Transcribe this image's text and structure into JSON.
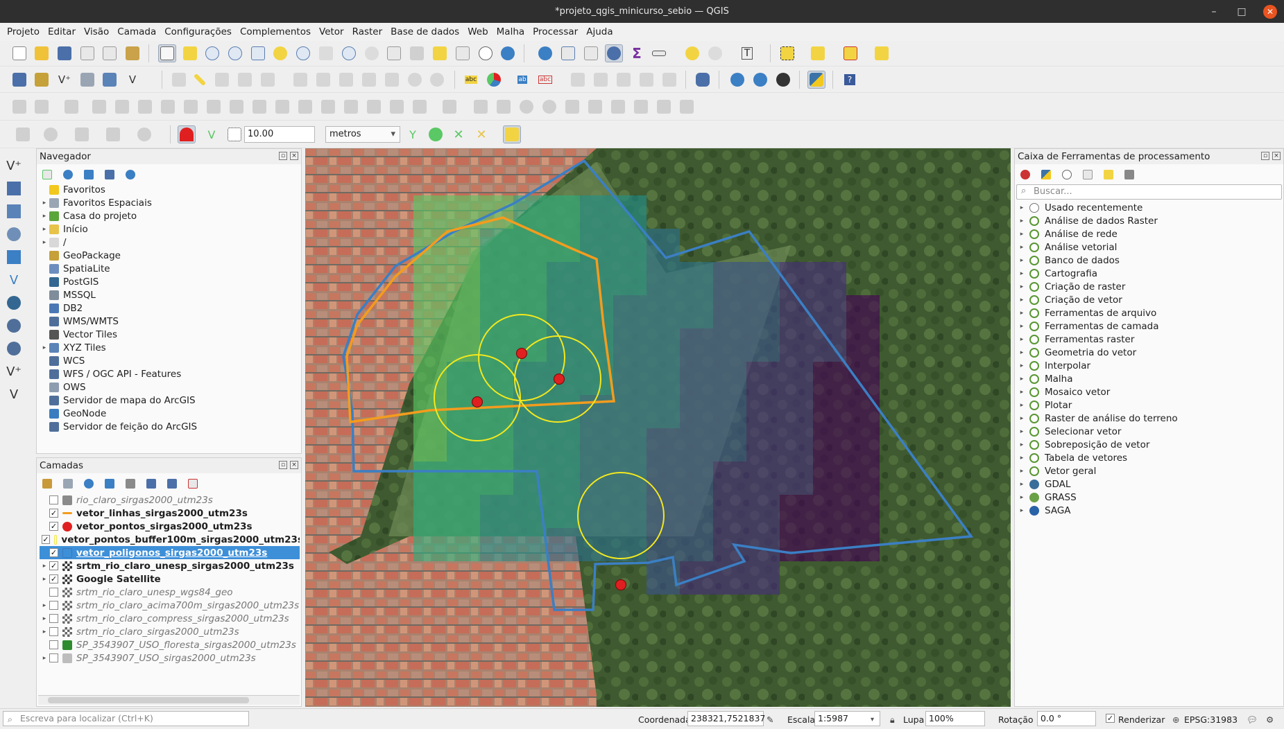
{
  "window": {
    "title": "*projeto_qgis_minicurso_sebio — QGIS",
    "minimize": "–",
    "maximize": "□",
    "close": "✕"
  },
  "menus": [
    "Projeto",
    "Editar",
    "Visão",
    "Camada",
    "Configurações",
    "Complementos",
    "Vetor",
    "Raster",
    "Base de dados",
    "Web",
    "Malha",
    "Processar",
    "Ajuda"
  ],
  "snapping": {
    "tolerance": "10.00",
    "units": "metros"
  },
  "browser": {
    "title": "Navegador",
    "items": [
      {
        "label": "Favoritos",
        "icon": "star-icon",
        "expandable": false,
        "color": "#f2c81e"
      },
      {
        "label": "Favoritos Espaciais",
        "icon": "spatial-bookmarks-icon",
        "expandable": true,
        "color": "#9aa5b4"
      },
      {
        "label": "Casa do projeto",
        "icon": "project-home-icon",
        "expandable": true,
        "color": "#5ba63b"
      },
      {
        "label": "Início",
        "icon": "home-folder-icon",
        "expandable": true,
        "color": "#e8c34a"
      },
      {
        "label": "/",
        "icon": "root-folder-icon",
        "expandable": true,
        "color": "#d8d8d8"
      },
      {
        "label": "GeoPackage",
        "icon": "geopackage-icon",
        "expandable": false,
        "color": "#c6a13a"
      },
      {
        "label": "SpatiaLite",
        "icon": "spatialite-icon",
        "expandable": false,
        "color": "#6c8ebf"
      },
      {
        "label": "PostGIS",
        "icon": "postgis-icon",
        "expandable": false,
        "color": "#336791"
      },
      {
        "label": "MSSQL",
        "icon": "mssql-icon",
        "expandable": false,
        "color": "#7f8c9a"
      },
      {
        "label": "DB2",
        "icon": "db2-icon",
        "expandable": false,
        "color": "#4a78b5"
      },
      {
        "label": "WMS/WMTS",
        "icon": "wms-globe-icon",
        "expandable": false,
        "color": "#4f6f9a"
      },
      {
        "label": "Vector Tiles",
        "icon": "vector-tiles-icon",
        "expandable": false,
        "color": "#555555"
      },
      {
        "label": "XYZ Tiles",
        "icon": "xyz-tiles-icon",
        "expandable": true,
        "color": "#5a83b8"
      },
      {
        "label": "WCS",
        "icon": "wcs-globe-icon",
        "expandable": false,
        "color": "#4f6f9a"
      },
      {
        "label": "WFS / OGC API - Features",
        "icon": "wfs-globe-icon",
        "expandable": false,
        "color": "#4f6f9a"
      },
      {
        "label": "OWS",
        "icon": "ows-globe-icon",
        "expandable": false,
        "color": "#8e9cb0"
      },
      {
        "label": "Servidor de mapa do ArcGIS",
        "icon": "arcgis-map-icon",
        "expandable": false,
        "color": "#4f6f9a"
      },
      {
        "label": "GeoNode",
        "icon": "geonode-icon",
        "expandable": false,
        "color": "#3a7cc0"
      },
      {
        "label": "Servidor de feição do ArcGIS",
        "icon": "arcgis-feature-icon",
        "expandable": false,
        "color": "#4f6f9a"
      }
    ]
  },
  "layers": {
    "title": "Camadas",
    "items": [
      {
        "name": "rio_claro_sirgas2000_utm23s",
        "checked": false,
        "bold": false,
        "italic": true,
        "expandable": false,
        "icon": "raster-gray-icon",
        "color": "#8a8a8a"
      },
      {
        "name": "vetor_linhas_sirgas2000_utm23s",
        "checked": true,
        "bold": true,
        "italic": false,
        "expandable": false,
        "icon": "line-orange-icon",
        "color": "#f39c1e"
      },
      {
        "name": "vetor_pontos_sirgas2000_utm23s",
        "checked": true,
        "bold": true,
        "italic": false,
        "expandable": false,
        "icon": "point-red-icon",
        "color": "#e02020"
      },
      {
        "name": "vetor_pontos_buffer100m_sirgas2000_utm23s",
        "checked": true,
        "bold": true,
        "italic": false,
        "expandable": false,
        "icon": "polygon-yellow-icon",
        "color": "#f5e63a"
      },
      {
        "name": "vetor_poligonos_sirgas2000_utm23s",
        "checked": true,
        "bold": true,
        "italic": false,
        "expandable": false,
        "icon": "polygon-blue-icon",
        "color": "#3a78c0",
        "selected": true
      },
      {
        "name": "srtm_rio_claro_unesp_sirgas2000_utm23s",
        "checked": true,
        "bold": true,
        "italic": false,
        "expandable": true,
        "icon": "raster-icon",
        "color": "#333333"
      },
      {
        "name": "Google Satellite",
        "checked": true,
        "bold": true,
        "italic": false,
        "expandable": true,
        "icon": "raster-icon",
        "color": "#333333"
      },
      {
        "name": "srtm_rio_claro_unesp_wgs84_geo",
        "checked": false,
        "bold": false,
        "italic": true,
        "expandable": false,
        "icon": "raster-icon",
        "color": "#666666"
      },
      {
        "name": "srtm_rio_claro_acima700m_sirgas2000_utm23s",
        "checked": false,
        "bold": false,
        "italic": true,
        "expandable": true,
        "icon": "raster-icon",
        "color": "#666666"
      },
      {
        "name": "srtm_rio_claro_compress_sirgas2000_utm23s",
        "checked": false,
        "bold": false,
        "italic": true,
        "expandable": true,
        "icon": "raster-icon",
        "color": "#666666"
      },
      {
        "name": "srtm_rio_claro_sirgas2000_utm23s",
        "checked": false,
        "bold": false,
        "italic": true,
        "expandable": true,
        "icon": "raster-icon",
        "color": "#666666"
      },
      {
        "name": "SP_3543907_USO_floresta_sirgas2000_utm23s",
        "checked": false,
        "bold": false,
        "italic": true,
        "expandable": false,
        "icon": "polygon-green-icon",
        "color": "#2e8b2e"
      },
      {
        "name": "SP_3543907_USO_sirgas2000_utm23s",
        "checked": false,
        "bold": false,
        "italic": true,
        "expandable": true,
        "icon": "polygon-categorized-icon",
        "color": "#bdbdbd"
      }
    ]
  },
  "processing": {
    "title": "Caixa de Ferramentas de processamento",
    "search_placeholder": "Buscar...",
    "items": [
      {
        "label": "Usado recentemente",
        "icon": "clock-icon",
        "color": "#777777"
      },
      {
        "label": "Análise de dados Raster",
        "icon": "qgis-q-icon",
        "color": "#589632"
      },
      {
        "label": "Análise de rede",
        "icon": "qgis-q-icon",
        "color": "#589632"
      },
      {
        "label": "Análise vetorial",
        "icon": "qgis-q-icon",
        "color": "#589632"
      },
      {
        "label": "Banco de dados",
        "icon": "qgis-q-icon",
        "color": "#589632"
      },
      {
        "label": "Cartografia",
        "icon": "qgis-q-icon",
        "color": "#589632"
      },
      {
        "label": "Criação de raster",
        "icon": "qgis-q-icon",
        "color": "#589632"
      },
      {
        "label": "Criação de vetor",
        "icon": "qgis-q-icon",
        "color": "#589632"
      },
      {
        "label": "Ferramentas de arquivo",
        "icon": "qgis-q-icon",
        "color": "#589632"
      },
      {
        "label": "Ferramentas de camada",
        "icon": "qgis-q-icon",
        "color": "#589632"
      },
      {
        "label": "Ferramentas raster",
        "icon": "qgis-q-icon",
        "color": "#589632"
      },
      {
        "label": "Geometria do vetor",
        "icon": "qgis-q-icon",
        "color": "#589632"
      },
      {
        "label": "Interpolar",
        "icon": "qgis-q-icon",
        "color": "#589632"
      },
      {
        "label": "Malha",
        "icon": "qgis-q-icon",
        "color": "#589632"
      },
      {
        "label": "Mosaico vetor",
        "icon": "qgis-q-icon",
        "color": "#589632"
      },
      {
        "label": "Plotar",
        "icon": "qgis-q-icon",
        "color": "#589632"
      },
      {
        "label": "Raster de análise do terreno",
        "icon": "qgis-q-icon",
        "color": "#589632"
      },
      {
        "label": "Selecionar vetor",
        "icon": "qgis-q-icon",
        "color": "#589632"
      },
      {
        "label": "Sobreposição de vetor",
        "icon": "qgis-q-icon",
        "color": "#589632"
      },
      {
        "label": "Tabela de vetores",
        "icon": "qgis-q-icon",
        "color": "#589632"
      },
      {
        "label": "Vetor geral",
        "icon": "qgis-q-icon",
        "color": "#589632"
      },
      {
        "label": "GDAL",
        "icon": "gdal-icon",
        "color": "#3a6e9a"
      },
      {
        "label": "GRASS",
        "icon": "grass-icon",
        "color": "#6aa046"
      },
      {
        "label": "SAGA",
        "icon": "saga-icon",
        "color": "#2a62a8"
      }
    ]
  },
  "statusbar": {
    "locator_placeholder": "Escreva para localizar (Ctrl+K)",
    "coord_label": "Coordenada",
    "coord_value": "238321,7521837",
    "scale_label": "Escala",
    "scale_value": "1:5987",
    "magnifier_label": "Lupa",
    "magnifier_value": "100%",
    "rotation_label": "Rotação",
    "rotation_value": "0.0 °",
    "render_label": "Renderizar",
    "render_checked": true,
    "crs": "EPSG:31983"
  },
  "map_colors": {
    "polygon_outline": "#3b7fc4",
    "line": "#f39c1e",
    "point_fill": "#e02020",
    "buffer_outline": "#f3e81e",
    "dem_ramp": [
      "#9bd23f",
      "#5ac864",
      "#2ab07f",
      "#21918c",
      "#2c728e",
      "#3b528b",
      "#472d7b",
      "#440154"
    ]
  },
  "colors": {
    "selection": "#3d8fd8",
    "titlebar": "#2f2f2f",
    "close_button": "#e95420"
  }
}
